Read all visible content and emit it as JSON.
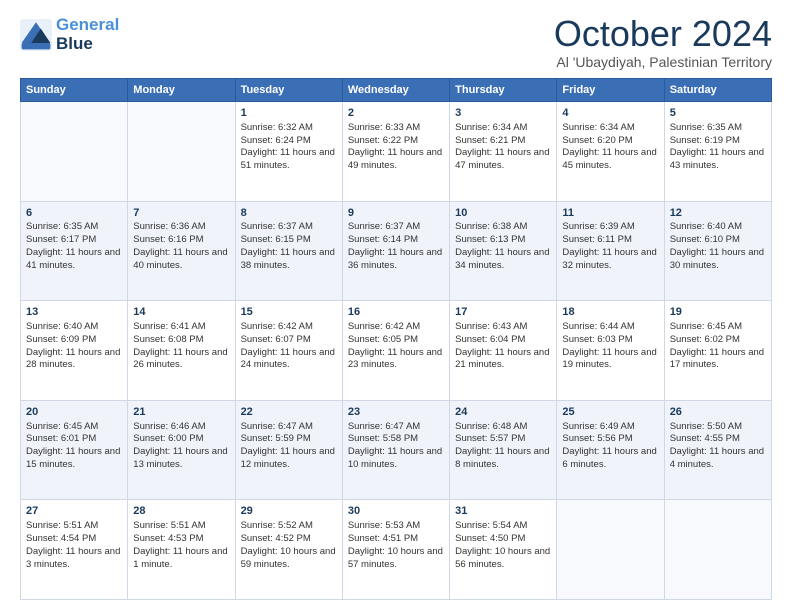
{
  "header": {
    "logo_general": "General",
    "logo_blue": "Blue",
    "month": "October 2024",
    "location": "Al 'Ubaydiyah, Palestinian Territory"
  },
  "weekdays": [
    "Sunday",
    "Monday",
    "Tuesday",
    "Wednesday",
    "Thursday",
    "Friday",
    "Saturday"
  ],
  "weeks": [
    [
      {
        "day": "",
        "sunrise": "",
        "sunset": "",
        "daylight": ""
      },
      {
        "day": "",
        "sunrise": "",
        "sunset": "",
        "daylight": ""
      },
      {
        "day": "1",
        "sunrise": "Sunrise: 6:32 AM",
        "sunset": "Sunset: 6:24 PM",
        "daylight": "Daylight: 11 hours and 51 minutes."
      },
      {
        "day": "2",
        "sunrise": "Sunrise: 6:33 AM",
        "sunset": "Sunset: 6:22 PM",
        "daylight": "Daylight: 11 hours and 49 minutes."
      },
      {
        "day": "3",
        "sunrise": "Sunrise: 6:34 AM",
        "sunset": "Sunset: 6:21 PM",
        "daylight": "Daylight: 11 hours and 47 minutes."
      },
      {
        "day": "4",
        "sunrise": "Sunrise: 6:34 AM",
        "sunset": "Sunset: 6:20 PM",
        "daylight": "Daylight: 11 hours and 45 minutes."
      },
      {
        "day": "5",
        "sunrise": "Sunrise: 6:35 AM",
        "sunset": "Sunset: 6:19 PM",
        "daylight": "Daylight: 11 hours and 43 minutes."
      }
    ],
    [
      {
        "day": "6",
        "sunrise": "Sunrise: 6:35 AM",
        "sunset": "Sunset: 6:17 PM",
        "daylight": "Daylight: 11 hours and 41 minutes."
      },
      {
        "day": "7",
        "sunrise": "Sunrise: 6:36 AM",
        "sunset": "Sunset: 6:16 PM",
        "daylight": "Daylight: 11 hours and 40 minutes."
      },
      {
        "day": "8",
        "sunrise": "Sunrise: 6:37 AM",
        "sunset": "Sunset: 6:15 PM",
        "daylight": "Daylight: 11 hours and 38 minutes."
      },
      {
        "day": "9",
        "sunrise": "Sunrise: 6:37 AM",
        "sunset": "Sunset: 6:14 PM",
        "daylight": "Daylight: 11 hours and 36 minutes."
      },
      {
        "day": "10",
        "sunrise": "Sunrise: 6:38 AM",
        "sunset": "Sunset: 6:13 PM",
        "daylight": "Daylight: 11 hours and 34 minutes."
      },
      {
        "day": "11",
        "sunrise": "Sunrise: 6:39 AM",
        "sunset": "Sunset: 6:11 PM",
        "daylight": "Daylight: 11 hours and 32 minutes."
      },
      {
        "day": "12",
        "sunrise": "Sunrise: 6:40 AM",
        "sunset": "Sunset: 6:10 PM",
        "daylight": "Daylight: 11 hours and 30 minutes."
      }
    ],
    [
      {
        "day": "13",
        "sunrise": "Sunrise: 6:40 AM",
        "sunset": "Sunset: 6:09 PM",
        "daylight": "Daylight: 11 hours and 28 minutes."
      },
      {
        "day": "14",
        "sunrise": "Sunrise: 6:41 AM",
        "sunset": "Sunset: 6:08 PM",
        "daylight": "Daylight: 11 hours and 26 minutes."
      },
      {
        "day": "15",
        "sunrise": "Sunrise: 6:42 AM",
        "sunset": "Sunset: 6:07 PM",
        "daylight": "Daylight: 11 hours and 24 minutes."
      },
      {
        "day": "16",
        "sunrise": "Sunrise: 6:42 AM",
        "sunset": "Sunset: 6:05 PM",
        "daylight": "Daylight: 11 hours and 23 minutes."
      },
      {
        "day": "17",
        "sunrise": "Sunrise: 6:43 AM",
        "sunset": "Sunset: 6:04 PM",
        "daylight": "Daylight: 11 hours and 21 minutes."
      },
      {
        "day": "18",
        "sunrise": "Sunrise: 6:44 AM",
        "sunset": "Sunset: 6:03 PM",
        "daylight": "Daylight: 11 hours and 19 minutes."
      },
      {
        "day": "19",
        "sunrise": "Sunrise: 6:45 AM",
        "sunset": "Sunset: 6:02 PM",
        "daylight": "Daylight: 11 hours and 17 minutes."
      }
    ],
    [
      {
        "day": "20",
        "sunrise": "Sunrise: 6:45 AM",
        "sunset": "Sunset: 6:01 PM",
        "daylight": "Daylight: 11 hours and 15 minutes."
      },
      {
        "day": "21",
        "sunrise": "Sunrise: 6:46 AM",
        "sunset": "Sunset: 6:00 PM",
        "daylight": "Daylight: 11 hours and 13 minutes."
      },
      {
        "day": "22",
        "sunrise": "Sunrise: 6:47 AM",
        "sunset": "Sunset: 5:59 PM",
        "daylight": "Daylight: 11 hours and 12 minutes."
      },
      {
        "day": "23",
        "sunrise": "Sunrise: 6:47 AM",
        "sunset": "Sunset: 5:58 PM",
        "daylight": "Daylight: 11 hours and 10 minutes."
      },
      {
        "day": "24",
        "sunrise": "Sunrise: 6:48 AM",
        "sunset": "Sunset: 5:57 PM",
        "daylight": "Daylight: 11 hours and 8 minutes."
      },
      {
        "day": "25",
        "sunrise": "Sunrise: 6:49 AM",
        "sunset": "Sunset: 5:56 PM",
        "daylight": "Daylight: 11 hours and 6 minutes."
      },
      {
        "day": "26",
        "sunrise": "Sunrise: 5:50 AM",
        "sunset": "Sunset: 4:55 PM",
        "daylight": "Daylight: 11 hours and 4 minutes."
      }
    ],
    [
      {
        "day": "27",
        "sunrise": "Sunrise: 5:51 AM",
        "sunset": "Sunset: 4:54 PM",
        "daylight": "Daylight: 11 hours and 3 minutes."
      },
      {
        "day": "28",
        "sunrise": "Sunrise: 5:51 AM",
        "sunset": "Sunset: 4:53 PM",
        "daylight": "Daylight: 11 hours and 1 minute."
      },
      {
        "day": "29",
        "sunrise": "Sunrise: 5:52 AM",
        "sunset": "Sunset: 4:52 PM",
        "daylight": "Daylight: 10 hours and 59 minutes."
      },
      {
        "day": "30",
        "sunrise": "Sunrise: 5:53 AM",
        "sunset": "Sunset: 4:51 PM",
        "daylight": "Daylight: 10 hours and 57 minutes."
      },
      {
        "day": "31",
        "sunrise": "Sunrise: 5:54 AM",
        "sunset": "Sunset: 4:50 PM",
        "daylight": "Daylight: 10 hours and 56 minutes."
      },
      {
        "day": "",
        "sunrise": "",
        "sunset": "",
        "daylight": ""
      },
      {
        "day": "",
        "sunrise": "",
        "sunset": "",
        "daylight": ""
      }
    ]
  ]
}
